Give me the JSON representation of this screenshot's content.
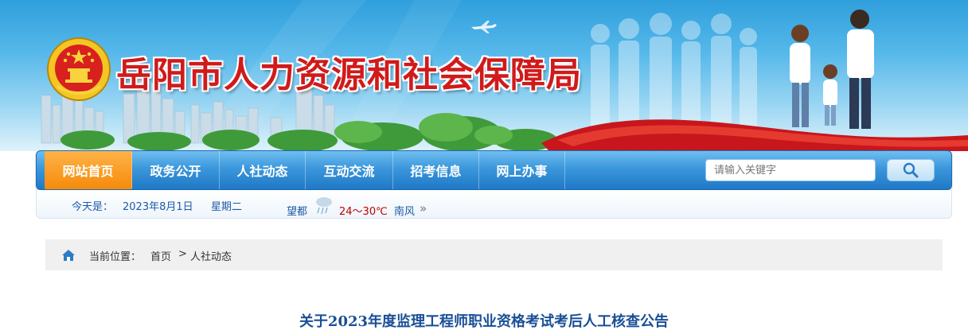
{
  "site": {
    "title": "岳阳市人力资源和社会保障局"
  },
  "nav": {
    "items": [
      {
        "label": "网站首页",
        "active": true
      },
      {
        "label": "政务公开",
        "active": false
      },
      {
        "label": "人社动态",
        "active": false
      },
      {
        "label": "互动交流",
        "active": false
      },
      {
        "label": "招考信息",
        "active": false
      },
      {
        "label": "网上办事",
        "active": false
      }
    ],
    "search": {
      "placeholder": "请输入关键字",
      "button_icon": "search-icon"
    }
  },
  "info": {
    "today_label": "今天是：",
    "date": "2023年8月1日",
    "weekday": "星期二",
    "weather": {
      "city": "望都",
      "icon": "weather-icon",
      "temp": "24～30℃",
      "wind": "南风",
      "more": "»"
    }
  },
  "breadcrumb": {
    "icon": "home-icon",
    "label": "当前位置：",
    "items": [
      "首页",
      "人社动态"
    ],
    "separator": ">"
  },
  "article": {
    "title": "关于2023年度监理工程师职业资格考试考后人工核查公告"
  },
  "colors": {
    "nav_blue": "#2f86d1",
    "nav_active": "#f58a0b",
    "title_red": "#d11a1a",
    "link_blue": "#1e5aa8",
    "article_blue": "#1a4f96"
  }
}
